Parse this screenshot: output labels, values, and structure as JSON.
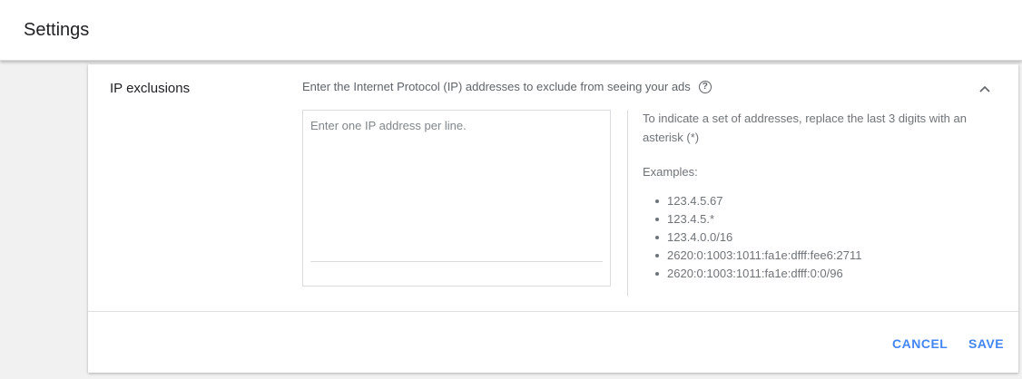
{
  "header": {
    "title": "Settings"
  },
  "section": {
    "label": "IP exclusions",
    "description": "Enter the Internet Protocol (IP) addresses to exclude from seeing your ads",
    "help_icon": "help-circle-icon",
    "collapse_icon": "chevron-up-icon"
  },
  "ip_input": {
    "placeholder": "Enter one IP address per line.",
    "value": ""
  },
  "help_panel": {
    "instruction": "To indicate a set of addresses, replace the last 3 digits with an asterisk (*)",
    "examples_heading": "Examples:",
    "examples": [
      "123.4.5.67",
      "123.4.5.*",
      "123.4.0.0/16",
      "2620:0:1003:1011:fa1e:dfff:fee6:2711",
      "2620:0:1003:1011:fa1e:dfff:0:0/96"
    ]
  },
  "actions": {
    "cancel_label": "CANCEL",
    "save_label": "SAVE"
  },
  "colors": {
    "accent": "#4285f4",
    "background": "#f1f1f1",
    "card": "#ffffff",
    "text_primary": "#202124",
    "text_secondary": "#5f6368"
  }
}
